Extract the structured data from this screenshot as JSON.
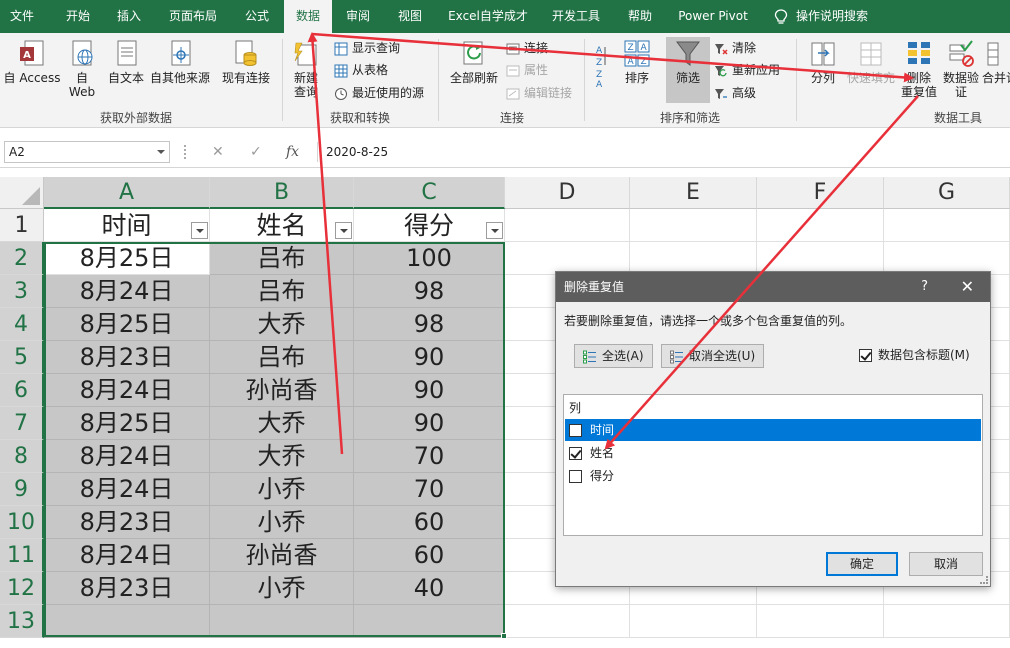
{
  "tabs": [
    "文件",
    "开始",
    "插入",
    "页面布局",
    "公式",
    "数据",
    "审阅",
    "视图",
    "Excel自学成才",
    "开发工具",
    "帮助",
    "Power Pivot",
    "操作说明搜索"
  ],
  "active_tab": "数据",
  "ribbon": {
    "get_external": {
      "access": "自 Access",
      "web_line1": "自",
      "web_line2": "Web",
      "text": "自文本",
      "other": "自其他来源",
      "existing": "现有连接",
      "group": "获取外部数据"
    },
    "get_transform": {
      "new_query_line1": "新建",
      "new_query_line2": "查询",
      "show_queries": "显示查询",
      "from_table": "从表格",
      "recent_sources": "最近使用的源",
      "group": "获取和转换"
    },
    "connections": {
      "refresh_all": "全部刷新",
      "connections": "连接",
      "properties": "属性",
      "edit_links": "编辑链接",
      "group": "连接"
    },
    "sort_filter": {
      "sort": "排序",
      "filter": "筛选",
      "clear": "清除",
      "reapply": "重新应用",
      "advanced": "高级",
      "group": "排序和筛选"
    },
    "data_tools": {
      "text_to_columns": "分列",
      "flash_fill": "快速填充",
      "remove_dup_line1": "删除",
      "remove_dup_line2": "重复值",
      "validation_line1": "数据验",
      "validation_line2": "证",
      "consolidate": "合并计",
      "group": "数据工具"
    }
  },
  "formula_bar": {
    "name_box": "A2",
    "value": "2020-8-25"
  },
  "columns": [
    "A",
    "B",
    "C",
    "D",
    "E",
    "F",
    "G"
  ],
  "rows": [
    "1",
    "2",
    "3",
    "4",
    "5",
    "6",
    "7",
    "8",
    "9",
    "10",
    "11",
    "12",
    "13"
  ],
  "table": {
    "headers": [
      "时间",
      "姓名",
      "得分"
    ],
    "rows": [
      [
        "8月25日",
        "吕布",
        "100"
      ],
      [
        "8月24日",
        "吕布",
        "98"
      ],
      [
        "8月25日",
        "大乔",
        "98"
      ],
      [
        "8月23日",
        "吕布",
        "90"
      ],
      [
        "8月24日",
        "孙尚香",
        "90"
      ],
      [
        "8月25日",
        "大乔",
        "90"
      ],
      [
        "8月24日",
        "大乔",
        "70"
      ],
      [
        "8月24日",
        "小乔",
        "70"
      ],
      [
        "8月23日",
        "小乔",
        "60"
      ],
      [
        "8月24日",
        "孙尚香",
        "60"
      ],
      [
        "8月23日",
        "小乔",
        "40"
      ]
    ]
  },
  "dialog": {
    "title": "删除重复值",
    "help": "?",
    "close": "✕",
    "instruction": "若要删除重复值，请选择一个或多个包含重复值的列。",
    "select_all": "全选(A)",
    "unselect_all": "取消全选(U)",
    "has_headers": "数据包含标题(M)",
    "has_headers_checked": true,
    "list_header": "列",
    "columns": [
      {
        "label": "时间",
        "checked": false,
        "selected": true
      },
      {
        "label": "姓名",
        "checked": true,
        "selected": false
      },
      {
        "label": "得分",
        "checked": false,
        "selected": false
      }
    ],
    "ok": "确定",
    "cancel": "取消"
  },
  "colors": {
    "excel_green": "#217346",
    "selection_blue": "#0078d7",
    "annotation_red": "#e8303a",
    "cell_shade": "#c7c7c7"
  }
}
